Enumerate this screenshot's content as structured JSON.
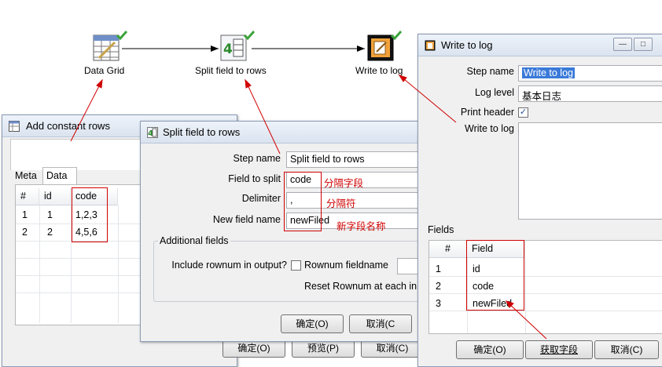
{
  "canvas": {
    "nodes": [
      {
        "label": "Data Grid",
        "icon": "data-grid-icon"
      },
      {
        "label": "Split field to rows",
        "icon": "split-field-icon"
      },
      {
        "label": "Write to log",
        "icon": "write-to-log-icon"
      }
    ]
  },
  "add_constant_rows": {
    "title": "Add constant rows",
    "tabs": [
      "Meta",
      "Data"
    ],
    "columns": [
      "#",
      "id",
      "code"
    ],
    "rows": [
      [
        "1",
        "1",
        "1,2,3"
      ],
      [
        "2",
        "2",
        "4,5,6"
      ]
    ],
    "buttons": [
      "确定(O)",
      "预览(P)",
      "取消(C)"
    ]
  },
  "split_dialog": {
    "title": "Split field to rows",
    "step_name_label": "Step name",
    "step_name_value": "Split field to rows",
    "field_to_split_label": "Field to split",
    "field_to_split_value": "code",
    "field_to_split_note": "分隔字段",
    "delimiter_label": "Delimiter",
    "delimiter_value": ",",
    "delimiter_note": "分隔符",
    "new_field_label": "New field name",
    "new_field_value": "newFiled",
    "new_field_note": "新字段名称",
    "additional_fields_label": "Additional fields",
    "include_rownum_label": "Include rownum in output?",
    "rownum_fieldname_label": "Rownum fieldname",
    "reset_rownum_label": "Reset Rownum at each in",
    "ok_button": "确定(O)",
    "cancel_button": "取消(C"
  },
  "write_log_dialog": {
    "title": "Write to log",
    "step_name_label": "Step name",
    "step_name_value": "Write to log",
    "log_level_label": "Log level",
    "log_level_value": "基本日志",
    "print_header_label": "Print header",
    "write_to_log_label": "Write to log",
    "fields_label": "Fields",
    "grid_columns": [
      "#",
      "Field"
    ],
    "grid_rows": [
      [
        "1",
        "id"
      ],
      [
        "2",
        "code"
      ],
      [
        "3",
        "newFiled"
      ]
    ],
    "ok_button": "确定(O)",
    "get_fields_button": "获取字段",
    "cancel_button": "取消(C)"
  },
  "colors": {
    "annotation_red": "#d00000",
    "selection_blue": "#3a7ad9"
  }
}
